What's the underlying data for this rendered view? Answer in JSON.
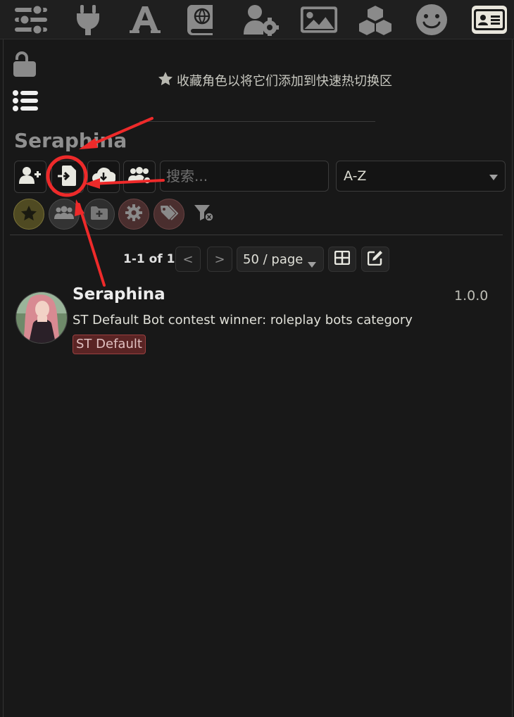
{
  "top_nav": {
    "icons": [
      "sliders-icon",
      "plug-icon",
      "font-icon",
      "book-atlas-icon",
      "user-gear-icon",
      "image-icon",
      "cubes-icon",
      "smiley-icon",
      "address-card-icon"
    ]
  },
  "panel": {
    "hint_text": "收藏角色以将它们添加到快速热切换区",
    "selected_character": "Seraphina",
    "search": {
      "placeholder": "搜索..."
    },
    "sort": {
      "value": "A-Z"
    },
    "pagination": {
      "summary": "1-1 of 1",
      "prev": "<",
      "next": ">",
      "page_size": "50 / page"
    },
    "characters": [
      {
        "name": "Seraphina",
        "version": "1.0.0",
        "description": "ST Default Bot contest winner: roleplay bots category",
        "tag": "ST Default"
      }
    ]
  },
  "annotation": {
    "color": "#ee2a2a"
  }
}
